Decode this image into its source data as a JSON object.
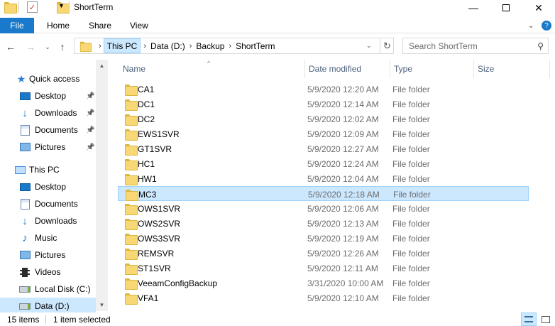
{
  "window": {
    "title": "ShortTerm"
  },
  "ribbon": {
    "tabs": [
      "File",
      "Home",
      "Share",
      "View"
    ]
  },
  "nav": {
    "breadcrumbs": [
      "This PC",
      "Data (D:)",
      "Backup",
      "ShortTerm"
    ],
    "search_placeholder": "Search ShortTerm"
  },
  "sidebar": {
    "quick_access": "Quick access",
    "quick_items": [
      {
        "label": "Desktop",
        "icon": "desktop-icon"
      },
      {
        "label": "Downloads",
        "icon": "downloads-icon"
      },
      {
        "label": "Documents",
        "icon": "documents-icon"
      },
      {
        "label": "Pictures",
        "icon": "pictures-icon"
      }
    ],
    "this_pc": "This PC",
    "pc_items": [
      {
        "label": "Desktop",
        "icon": "desktop-icon"
      },
      {
        "label": "Documents",
        "icon": "documents-icon"
      },
      {
        "label": "Downloads",
        "icon": "downloads-icon"
      },
      {
        "label": "Music",
        "icon": "music-icon"
      },
      {
        "label": "Pictures",
        "icon": "pictures-icon"
      },
      {
        "label": "Videos",
        "icon": "videos-icon"
      },
      {
        "label": "Local Disk (C:)",
        "icon": "drive-icon"
      },
      {
        "label": "Data (D:)",
        "icon": "drive-icon"
      }
    ]
  },
  "columns": [
    "Name",
    "Date modified",
    "Type",
    "Size"
  ],
  "files": [
    {
      "name": "CA1",
      "date": "5/9/2020 12:20 AM",
      "type": "File folder"
    },
    {
      "name": "DC1",
      "date": "5/9/2020 12:14 AM",
      "type": "File folder"
    },
    {
      "name": "DC2",
      "date": "5/9/2020 12:02 AM",
      "type": "File folder"
    },
    {
      "name": "EWS1SVR",
      "date": "5/9/2020 12:09 AM",
      "type": "File folder"
    },
    {
      "name": "GT1SVR",
      "date": "5/9/2020 12:27 AM",
      "type": "File folder"
    },
    {
      "name": "HC1",
      "date": "5/9/2020 12:24 AM",
      "type": "File folder"
    },
    {
      "name": "HW1",
      "date": "5/9/2020 12:04 AM",
      "type": "File folder"
    },
    {
      "name": "MC3",
      "date": "5/9/2020 12:18 AM",
      "type": "File folder"
    },
    {
      "name": "OWS1SVR",
      "date": "5/9/2020 12:06 AM",
      "type": "File folder"
    },
    {
      "name": "OWS2SVR",
      "date": "5/9/2020 12:13 AM",
      "type": "File folder"
    },
    {
      "name": "OWS3SVR",
      "date": "5/9/2020 12:19 AM",
      "type": "File folder"
    },
    {
      "name": "REMSVR",
      "date": "5/9/2020 12:26 AM",
      "type": "File folder"
    },
    {
      "name": "ST1SVR",
      "date": "5/9/2020 12:11 AM",
      "type": "File folder"
    },
    {
      "name": "VeeamConfigBackup",
      "date": "3/31/2020 10:00 AM",
      "type": "File folder"
    },
    {
      "name": "VFA1",
      "date": "5/9/2020 12:10 AM",
      "type": "File folder"
    }
  ],
  "selected_file": "MC3",
  "status": {
    "items": "15 items",
    "selected": "1 item selected"
  }
}
